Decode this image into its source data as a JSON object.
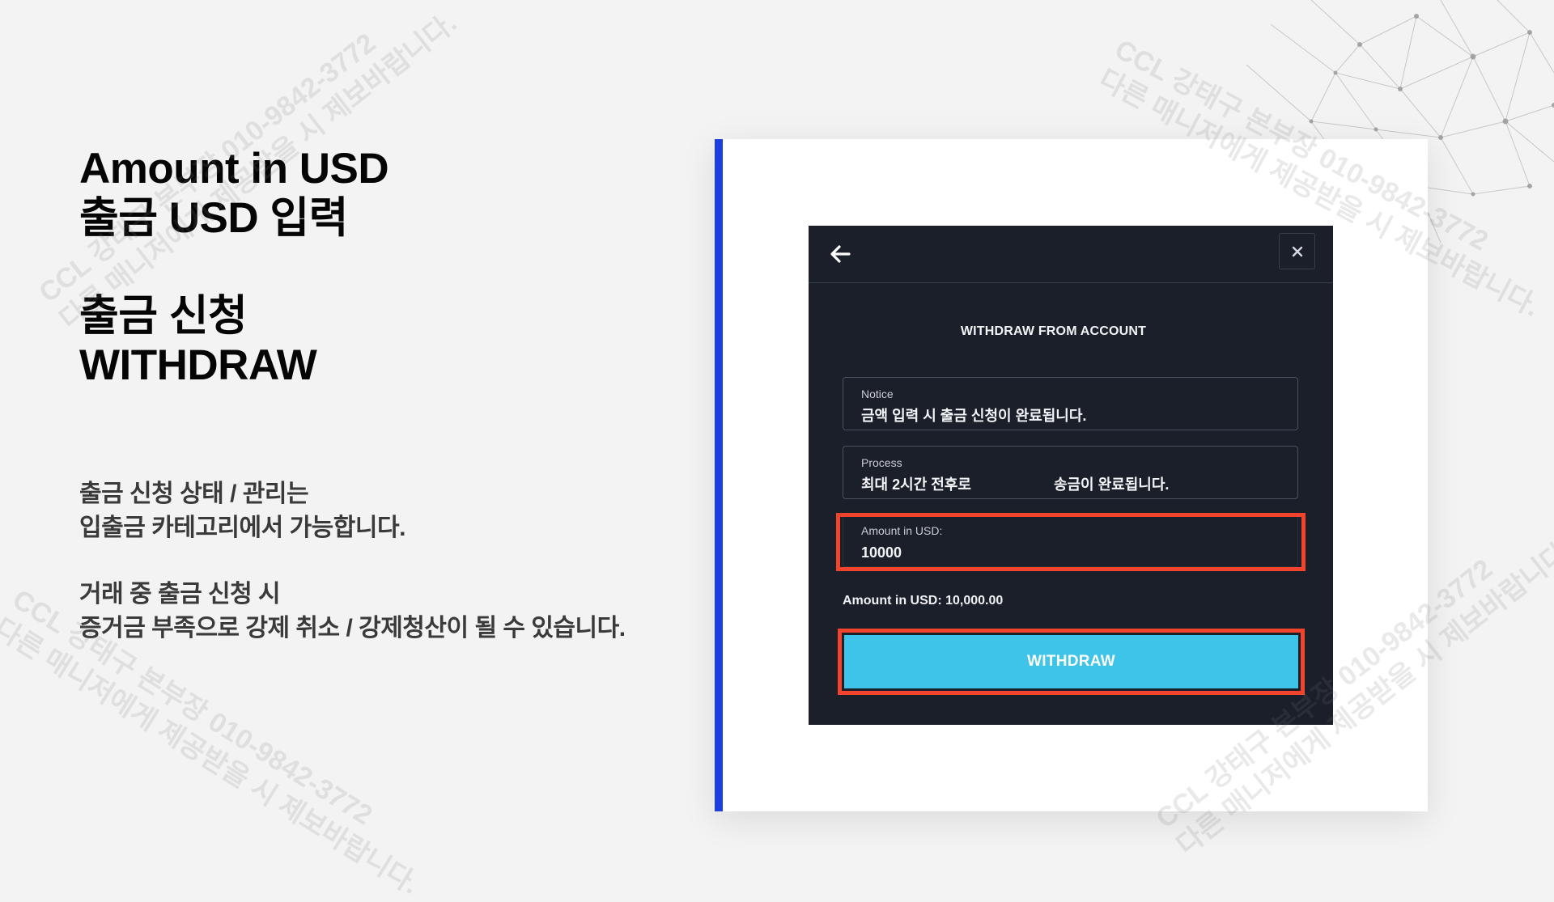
{
  "left_panel": {
    "heading1_line1": "Amount in USD",
    "heading1_line2": "출금 USD 입력",
    "heading2_line1": "출금 신청",
    "heading2_line2": "WITHDRAW",
    "desc1_line1": "출금 신청 상태 / 관리는",
    "desc1_line2": "입출금 카테고리에서 가능합니다.",
    "desc2_line1": "거래 중 출금 신청 시",
    "desc2_line2": "증거금 부족으로 강제 취소 / 강제청산이 될 수 있습니다."
  },
  "dialog": {
    "back_icon": "arrow-left-icon",
    "close_icon": "close-icon",
    "title": "WITHDRAW FROM ACCOUNT",
    "notice": {
      "label": "Notice",
      "value": "금액 입력 시 출금 신청이 완료됩니다."
    },
    "process": {
      "label": "Process",
      "value_part1": "최대 2시간 전후로",
      "value_part2": "송금이 완료됩니다."
    },
    "amount_input": {
      "label": "Amount in USD:",
      "value": "10000"
    },
    "summary": {
      "label": "Amount in USD:",
      "value": "10,000.00"
    },
    "withdraw_button": "WITHDRAW"
  },
  "watermark": {
    "line1": "CCL 강태구 본부장 010-9842-3772",
    "line2": "다른 매니저에게 제공받을 시 제보바랍니다."
  },
  "colors": {
    "background": "#f3f3f3",
    "accent_bar": "#1c3fe0",
    "dialog_bg": "#1b1f2a",
    "highlight": "#f2442c",
    "button": "#3dc4e8"
  }
}
